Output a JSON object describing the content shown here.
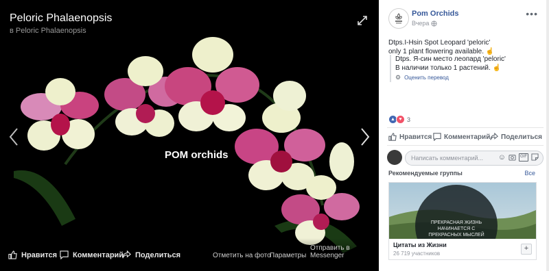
{
  "viewer": {
    "title": "Peloric Phalaenopsis",
    "album": "в Peloric Phalaenopsis",
    "watermark": "POM orchids",
    "actions": {
      "like": "Нравится",
      "comment": "Комментарий",
      "share": "Поделиться"
    },
    "links": {
      "tag": "Отметить на фото",
      "options": "Параметры",
      "messenger": "Отправить в Messenger"
    }
  },
  "post": {
    "page_name": "Pom Orchids",
    "time": "Вчера",
    "text_line1": "Dtps.I-Hsin Spot Leopard 'peloric'",
    "text_line2": "only 1 plant flowering available.",
    "translation_line1": "Dtps. Я-син место леопард 'peloric'",
    "translation_line2": "В наличии только 1 растений.",
    "rate_translation": "Оценить перевод",
    "reaction_count": "3",
    "actions": {
      "like": "Нравится",
      "comment": "Комментарий",
      "share": "Поделиться"
    },
    "comment_placeholder": "Написать комментарий..."
  },
  "recommended": {
    "title": "Рекомендуемые группы",
    "see_all": "Все",
    "group": {
      "quote": "ПРЕКРАСНАЯ ЖИЗНЬ НАЧИНАЕТСЯ С ПРЕКРАСНЫХ МЫСЛЕЙ",
      "name": "Цитаты из Жизни",
      "members": "26 719 участников"
    }
  },
  "colors": {
    "link": "#365899",
    "like": "#4267b2",
    "love": "#f25268"
  }
}
